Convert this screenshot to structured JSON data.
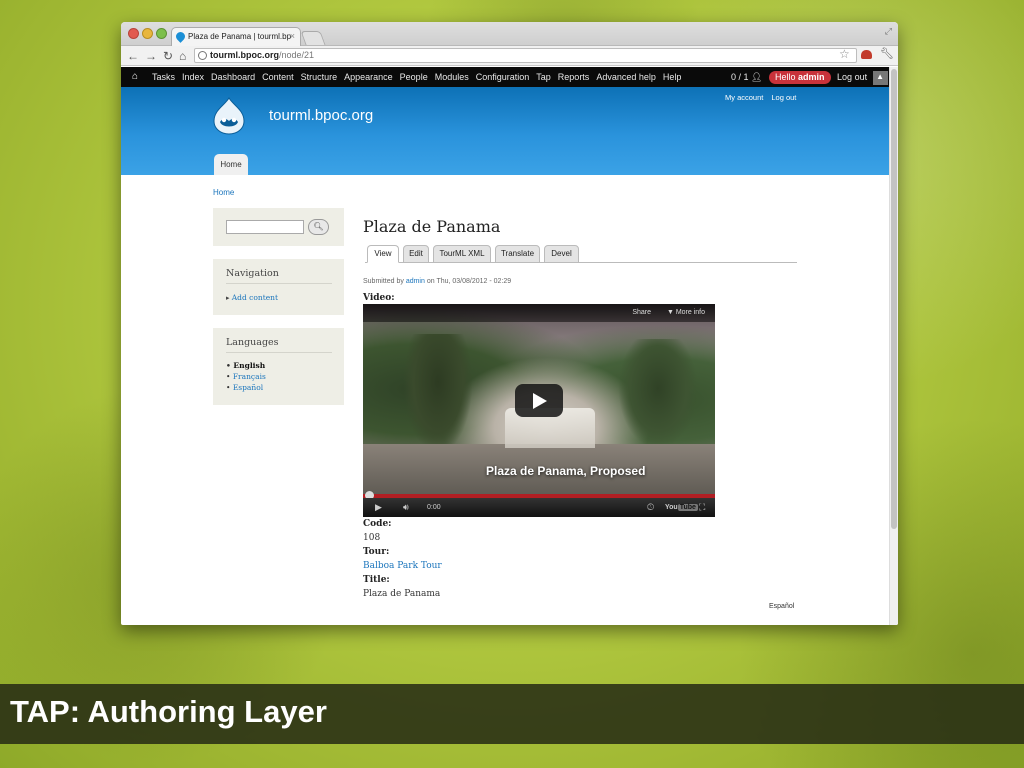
{
  "browser": {
    "tab_title": "Plaza de Panama | tourml.bp",
    "url_host": "tourml.bpoc.org",
    "url_path": "/node/21"
  },
  "admin_bar": {
    "menu": [
      "Tasks",
      "Index",
      "Dashboard",
      "Content",
      "Structure",
      "Appearance",
      "People",
      "Modules",
      "Configuration",
      "Tap",
      "Reports",
      "Advanced help",
      "Help"
    ],
    "user_count": "0 / 1",
    "hello_prefix": "Hello",
    "hello_user": "admin",
    "logout": "Log out"
  },
  "site": {
    "name": "tourml.bpoc.org",
    "secondary_menu": [
      "My account",
      "Log out"
    ],
    "home_tab": "Home"
  },
  "breadcrumb": "Home",
  "sidebar": {
    "navigation_title": "Navigation",
    "navigation_link": "Add content",
    "languages_title": "Languages",
    "languages": [
      "English",
      "Français",
      "Español"
    ]
  },
  "node": {
    "title": "Plaza de Panama",
    "tabs": [
      "View",
      "Edit",
      "TourML XML",
      "Translate",
      "Devel"
    ],
    "submitted_prefix": "Submitted by",
    "submitted_user": "admin",
    "submitted_suffix": "on Thu, 03/08/2012 - 02:29",
    "video_label": "Video:",
    "code_label": "Code:",
    "code_value": "108",
    "tour_label": "Tour:",
    "tour_value": "Balboa Park Tour",
    "title_label": "Title:",
    "title_value": "Plaza de Panama",
    "language_footer": "Español"
  },
  "video": {
    "share": "Share",
    "more_info": "More info",
    "caption": "Plaza de Panama, Proposed",
    "time": "0:00",
    "brand": "You",
    "brand_box": "Tube",
    "progress": 0
  },
  "slide": {
    "footer_title": "TAP: Authoring Layer"
  },
  "colors": {
    "admin_bar": "#0a0a0a",
    "header_blue": "#2a93dc",
    "hello_pill": "#c8323a",
    "link": "#1b75bc",
    "background_green": "#b2c940"
  }
}
